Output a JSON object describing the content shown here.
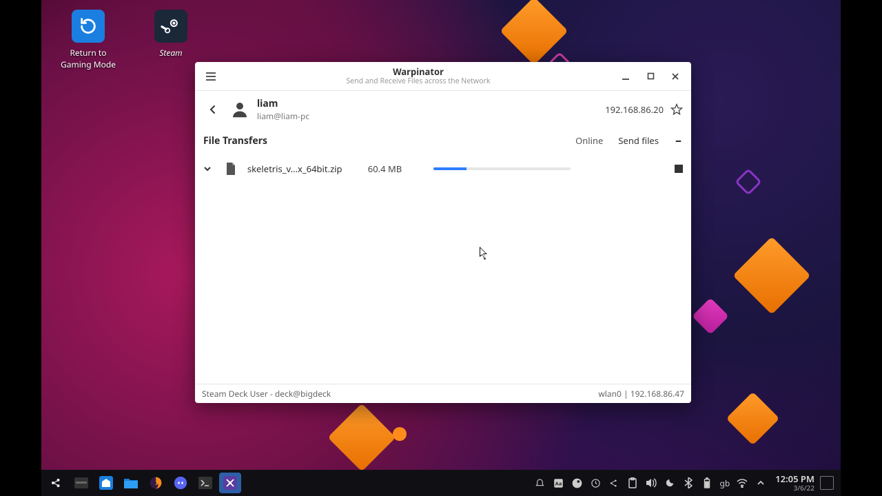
{
  "desktop_icons": {
    "return_to_gaming": "Return to\nGaming Mode",
    "steam": "Steam"
  },
  "window": {
    "title": "Warpinator",
    "subtitle": "Send and Receive Files across the Network",
    "peer": {
      "name": "liam",
      "address": "liam@liam-pc",
      "ip": "192.168.86.20"
    },
    "section_title": "File Transfers",
    "status": "Online",
    "send_label": "Send files",
    "transfer": {
      "filename": "skeletris_v...x_64bit.zip",
      "size": "60.4 MB",
      "progress_pct": 24
    },
    "footer_left": "Steam Deck User - deck@bigdeck",
    "footer_right": "wlan0 | 192.168.86.47"
  },
  "taskbar": {
    "kb_layout": "gb",
    "time": "12:05 PM",
    "date": "3/6/22"
  }
}
